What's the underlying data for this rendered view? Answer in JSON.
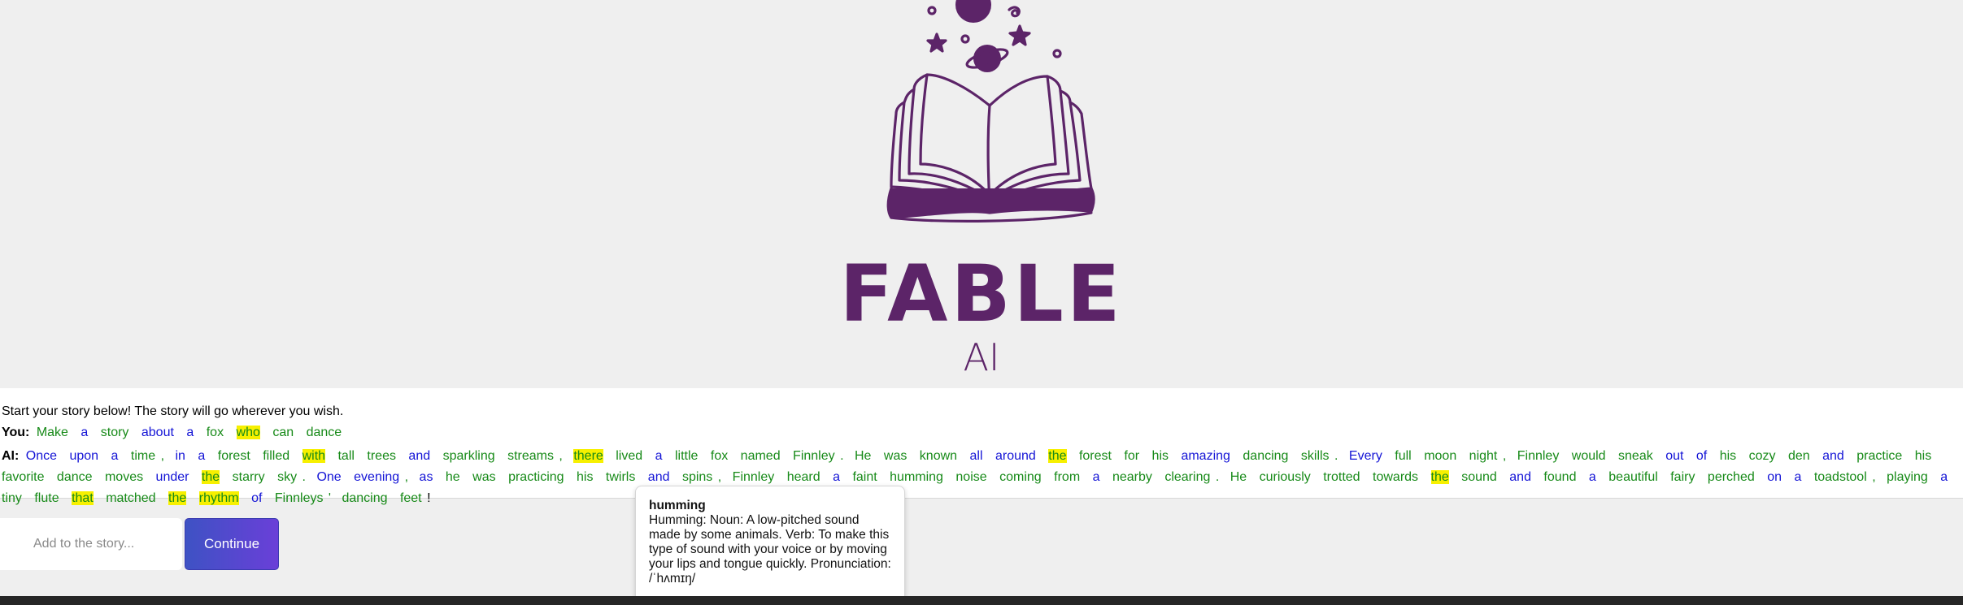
{
  "brand": {
    "title": "FABLE",
    "subtitle": "AI",
    "accent": "#5c2468"
  },
  "story": {
    "intro": "Start your story below! The story will go wherever you wish.",
    "you_label": "You:",
    "ai_label": "AI:",
    "user_words": [
      {
        "t": "Make",
        "c": "green"
      },
      {
        "t": "a",
        "c": "blue"
      },
      {
        "t": "story",
        "c": "green"
      },
      {
        "t": "about",
        "c": "blue"
      },
      {
        "t": "a",
        "c": "blue"
      },
      {
        "t": "fox",
        "c": "green"
      },
      {
        "t": "who",
        "c": "green",
        "hl": true
      },
      {
        "t": "can",
        "c": "green"
      },
      {
        "t": "dance",
        "c": "green"
      }
    ],
    "ai_words": [
      {
        "t": "Once",
        "c": "blue"
      },
      {
        "t": "upon",
        "c": "blue"
      },
      {
        "t": "a",
        "c": "blue"
      },
      {
        "t": "time",
        "c": "green"
      },
      {
        "t": ",",
        "p": true
      },
      {
        "t": "in",
        "c": "blue"
      },
      {
        "t": "a",
        "c": "blue"
      },
      {
        "t": "forest",
        "c": "green"
      },
      {
        "t": "filled",
        "c": "green"
      },
      {
        "t": "with",
        "c": "green",
        "hl": true
      },
      {
        "t": "tall",
        "c": "green"
      },
      {
        "t": "trees",
        "c": "green"
      },
      {
        "t": "and",
        "c": "blue"
      },
      {
        "t": "sparkling",
        "c": "green"
      },
      {
        "t": "streams",
        "c": "green"
      },
      {
        "t": ",",
        "p": true
      },
      {
        "t": "there",
        "c": "green",
        "hl": true
      },
      {
        "t": "lived",
        "c": "green"
      },
      {
        "t": "a",
        "c": "blue"
      },
      {
        "t": "little",
        "c": "green"
      },
      {
        "t": "fox",
        "c": "green"
      },
      {
        "t": "named",
        "c": "green"
      },
      {
        "t": "Finnley",
        "c": "green"
      },
      {
        "t": ".",
        "p": true
      },
      {
        "t": "He",
        "c": "green"
      },
      {
        "t": "was",
        "c": "green"
      },
      {
        "t": "known",
        "c": "green"
      },
      {
        "t": "all",
        "c": "blue"
      },
      {
        "t": "around",
        "c": "blue"
      },
      {
        "t": "the",
        "c": "green",
        "hl": true
      },
      {
        "t": "forest",
        "c": "green"
      },
      {
        "t": "for",
        "c": "green"
      },
      {
        "t": "his",
        "c": "green"
      },
      {
        "t": "amazing",
        "c": "blue"
      },
      {
        "t": "dancing",
        "c": "green"
      },
      {
        "t": "skills",
        "c": "green"
      },
      {
        "t": ".",
        "p": true
      },
      {
        "t": "Every",
        "c": "blue"
      },
      {
        "t": "full",
        "c": "green"
      },
      {
        "t": "moon",
        "c": "green"
      },
      {
        "t": "night",
        "c": "green"
      },
      {
        "t": ",",
        "p": true
      },
      {
        "t": "Finnley",
        "c": "green"
      },
      {
        "t": "would",
        "c": "green"
      },
      {
        "t": "sneak",
        "c": "green"
      },
      {
        "t": "out",
        "c": "blue"
      },
      {
        "t": "of",
        "c": "blue"
      },
      {
        "t": "his",
        "c": "green"
      },
      {
        "t": "cozy",
        "c": "green"
      },
      {
        "t": "den",
        "c": "green"
      },
      {
        "t": "and",
        "c": "blue"
      },
      {
        "t": "practice",
        "c": "green"
      },
      {
        "t": "his",
        "c": "green"
      },
      {
        "t": "favorite",
        "c": "green"
      },
      {
        "t": "dance",
        "c": "green"
      },
      {
        "t": "moves",
        "c": "green"
      },
      {
        "t": "under",
        "c": "blue"
      },
      {
        "t": "the",
        "c": "green",
        "hl": true
      },
      {
        "t": "starry",
        "c": "green"
      },
      {
        "t": "sky",
        "c": "green"
      },
      {
        "t": ".",
        "p": true
      },
      {
        "t": "One",
        "c": "blue"
      },
      {
        "t": "evening",
        "c": "blue"
      },
      {
        "t": ",",
        "p": true
      },
      {
        "t": "as",
        "c": "blue"
      },
      {
        "t": "he",
        "c": "green"
      },
      {
        "t": "was",
        "c": "green"
      },
      {
        "t": "practicing",
        "c": "green"
      },
      {
        "t": "his",
        "c": "green"
      },
      {
        "t": "twirls",
        "c": "green"
      },
      {
        "t": "and",
        "c": "blue"
      },
      {
        "t": "spins",
        "c": "green"
      },
      {
        "t": ",",
        "p": true
      },
      {
        "t": "Finnley",
        "c": "green"
      },
      {
        "t": "heard",
        "c": "green"
      },
      {
        "t": "a",
        "c": "blue"
      },
      {
        "t": "faint",
        "c": "green"
      },
      {
        "t": "humming",
        "c": "green"
      },
      {
        "t": "noise",
        "c": "green"
      },
      {
        "t": "coming",
        "c": "green"
      },
      {
        "t": "from",
        "c": "green"
      },
      {
        "t": "a",
        "c": "blue"
      },
      {
        "t": "nearby",
        "c": "green"
      },
      {
        "t": "clearing",
        "c": "green"
      },
      {
        "t": ".",
        "p": true
      },
      {
        "t": "He",
        "c": "green"
      },
      {
        "t": "curiously",
        "c": "green"
      },
      {
        "t": "trotted",
        "c": "green"
      },
      {
        "t": "towards",
        "c": "green"
      },
      {
        "t": "the",
        "c": "green",
        "hl": true
      },
      {
        "t": "sound",
        "c": "green"
      },
      {
        "t": "and",
        "c": "blue"
      },
      {
        "t": "found",
        "c": "green"
      },
      {
        "t": "a",
        "c": "blue"
      },
      {
        "t": "beautiful",
        "c": "green"
      },
      {
        "t": "fairy",
        "c": "green"
      },
      {
        "t": "perched",
        "c": "green"
      },
      {
        "t": "on",
        "c": "blue"
      },
      {
        "t": "a",
        "c": "blue"
      },
      {
        "t": "toadstool",
        "c": "green"
      },
      {
        "t": ",",
        "p": true
      },
      {
        "t": "playing",
        "c": "green"
      },
      {
        "t": "a",
        "c": "blue"
      },
      {
        "t": "tiny",
        "c": "green"
      },
      {
        "t": "flute",
        "c": "green"
      },
      {
        "t": "that",
        "c": "green",
        "hl": true
      },
      {
        "t": "matched",
        "c": "green"
      },
      {
        "t": "the",
        "c": "green",
        "hl": true
      },
      {
        "t": "rhythm",
        "c": "green",
        "hl": true
      },
      {
        "t": "of",
        "c": "blue"
      },
      {
        "t": "Finnleys",
        "c": "green"
      },
      {
        "t": "'",
        "p": true
      },
      {
        "t": "dancing",
        "c": "green"
      },
      {
        "t": "feet",
        "c": "green"
      },
      {
        "t": "!",
        "p": true,
        "dark": true
      }
    ]
  },
  "tooltip": {
    "word": "humming",
    "definition": "Humming: Noun: A low-pitched sound made by some animals. Verb: To make this type of sound with your voice or by moving your lips and tongue quickly. Pronunciation: /ˈhʌmɪŋ/"
  },
  "input": {
    "placeholder": "Add to the story...",
    "value": ""
  },
  "continue_label": "Continue",
  "icons": [
    "open-book-icon",
    "planet-icon",
    "moon-icon",
    "star-icon",
    "swirl-icon"
  ],
  "colors": {
    "green_word": "#178a18",
    "blue_word": "#1414d6",
    "highlight": "#f7f000",
    "button_start": "#3e52c4",
    "button_end": "#6a3fd8"
  }
}
